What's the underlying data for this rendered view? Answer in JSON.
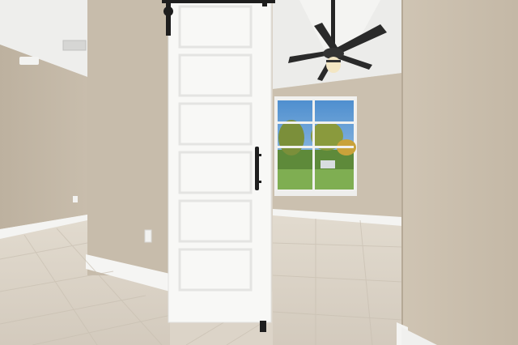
{
  "scene": {
    "description_hidden": "",
    "colors": {
      "wall": "#c9beae",
      "wall_shadow": "#b9ad9c",
      "ceiling": "#ececea",
      "floor": "#d8d0c3",
      "baseboard": "#f4f4f2",
      "door": "#f7f7f5",
      "hardware": "#1e1e1e",
      "window_sky": "#6fa6d6",
      "window_grass": "#7aa84f",
      "trees": "#5f7f35"
    },
    "icons": {
      "fan": "ceiling-fan-icon",
      "vent": "air-vent-icon",
      "outlet": "wall-outlet-icon"
    }
  }
}
